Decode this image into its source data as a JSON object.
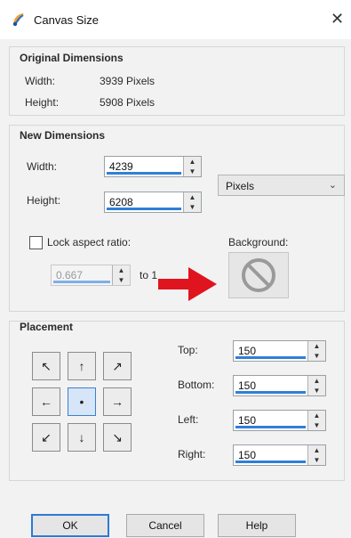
{
  "window": {
    "title": "Canvas Size",
    "close_glyph": "✕"
  },
  "original": {
    "title": "Original Dimensions",
    "width_label": "Width:",
    "width_value": "3939 Pixels",
    "height_label": "Height:",
    "height_value": "5908 Pixels"
  },
  "new_dims": {
    "title": "New Dimensions",
    "width_label": "Width:",
    "width_value": "4239",
    "height_label": "Height:",
    "height_value": "6208",
    "units": "Pixels",
    "lock_label": "Lock aspect ratio:",
    "ratio_value": "0.667",
    "ratio_to": "to 1",
    "background_label": "Background:"
  },
  "placement": {
    "title": "Placement",
    "top_label": "Top:",
    "top_value": "150",
    "bottom_label": "Bottom:",
    "bottom_value": "150",
    "left_label": "Left:",
    "left_value": "150",
    "right_label": "Right:",
    "right_value": "150",
    "grid_glyphs": [
      "↖",
      "↑",
      "↗",
      "←",
      "•",
      "→",
      "↙",
      "↓",
      "↘"
    ]
  },
  "spin_glyphs": {
    "up": "▲",
    "down": "▼"
  },
  "buttons": {
    "ok": "OK",
    "cancel": "Cancel",
    "help": "Help"
  },
  "icons": {
    "app": "paint-icon",
    "background": "no-symbol-icon",
    "annotation": "red-arrow-icon"
  },
  "colors": {
    "accent": "#2f7fd8",
    "annotation": "#e0141e"
  }
}
